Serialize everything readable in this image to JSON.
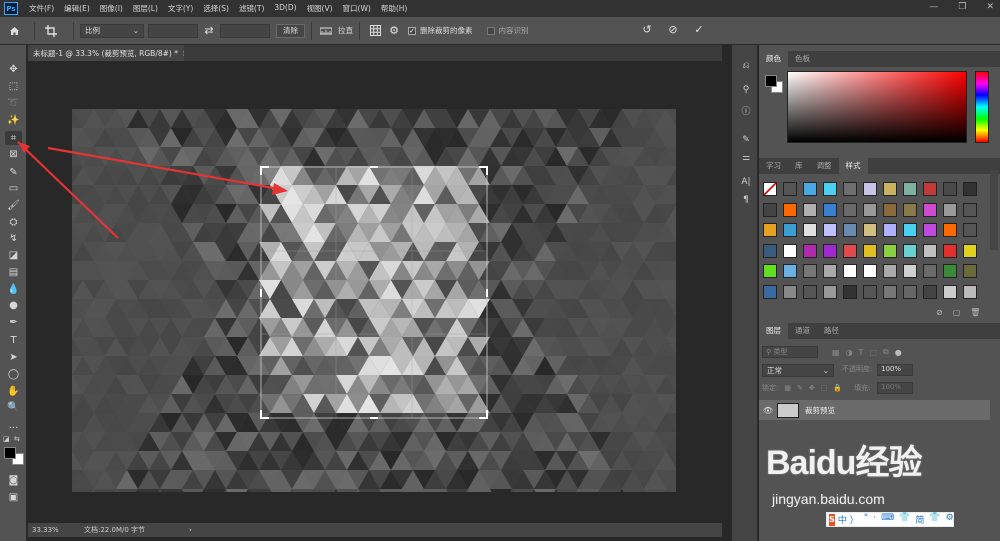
{
  "app": {
    "logo": "Ps"
  },
  "menu": [
    "文件(F)",
    "编辑(E)",
    "图像(I)",
    "图层(L)",
    "文字(Y)",
    "选择(S)",
    "滤镜(T)",
    "3D(D)",
    "视图(V)",
    "窗口(W)",
    "帮助(H)"
  ],
  "window_controls": {
    "minimize": "—",
    "restore": "❐",
    "close": "✕"
  },
  "options": {
    "ratio_select": "比例",
    "clear_button": "清除",
    "straighten_label": "拉直",
    "delete_cropped_label": "删除裁剪的像素",
    "delete_cropped_checked": true,
    "content_aware_label": "内容识别",
    "content_aware_checked": false,
    "swap_icon": "⇄",
    "reset_icon": "↺",
    "cancel_icon": "⊘",
    "commit_icon": "✓"
  },
  "document": {
    "tab_title": "未标题-1 @ 33.3% (裁剪预览, RGB/8#) *",
    "close": "×"
  },
  "status": {
    "zoom": "33.33%",
    "doc_info": "文档:22.0M/0 字节",
    "arrow": "›"
  },
  "tools": [
    {
      "name": "move-tool-icon",
      "glyph": "✥"
    },
    {
      "name": "marquee-tool-icon",
      "glyph": "⬚"
    },
    {
      "name": "lasso-tool-icon",
      "glyph": "➰"
    },
    {
      "name": "magic-wand-tool-icon",
      "glyph": "✨"
    },
    {
      "name": "crop-tool-icon",
      "glyph": "⌗"
    },
    {
      "name": "frame-tool-icon",
      "glyph": "⊠"
    },
    {
      "name": "eyedropper-tool-icon",
      "glyph": "✎"
    },
    {
      "name": "healing-brush-tool-icon",
      "glyph": "▭"
    },
    {
      "name": "brush-tool-icon",
      "glyph": "🖌"
    },
    {
      "name": "clone-stamp-tool-icon",
      "glyph": "⛭"
    },
    {
      "name": "history-brush-tool-icon",
      "glyph": "↯"
    },
    {
      "name": "eraser-tool-icon",
      "glyph": "◪"
    },
    {
      "name": "gradient-tool-icon",
      "glyph": "▤"
    },
    {
      "name": "blur-tool-icon",
      "glyph": "💧"
    },
    {
      "name": "dodge-tool-icon",
      "glyph": "●"
    },
    {
      "name": "pen-tool-icon",
      "glyph": "✒"
    },
    {
      "name": "type-tool-icon",
      "glyph": "T"
    },
    {
      "name": "path-selection-tool-icon",
      "glyph": "➤"
    },
    {
      "name": "shape-tool-icon",
      "glyph": "◯"
    },
    {
      "name": "hand-tool-icon",
      "glyph": "✋"
    },
    {
      "name": "zoom-tool-icon",
      "glyph": "🔍"
    },
    {
      "name": "more-tools-icon",
      "glyph": "···"
    }
  ],
  "panels": {
    "color_tabs": [
      "颜色",
      "色板"
    ],
    "style_tabs": [
      "字习",
      "库",
      "调整",
      "样式"
    ],
    "layer_tabs": [
      "图层",
      "通道",
      "路径"
    ],
    "layer_filter": "类型",
    "blend_mode": "正常",
    "opacity_label": "不透明度:",
    "opacity_value": "100%",
    "lock_label": "锁定:",
    "fill_label": "填充:",
    "fill_value": "100%",
    "layer_name": "裁剪预览",
    "eye_icon": "👁"
  },
  "watermark": {
    "brand": "Baidu经验",
    "url": "jingyan.baidu.com"
  },
  "ime": {
    "lang": "中",
    "glyphs": [
      "）",
      "°",
      "·",
      "⌨",
      "👕",
      "简",
      "👕",
      "⚙"
    ]
  },
  "colors": {
    "accent_blue": "#31a8ff",
    "arrow_red": "#e43434",
    "crop_handle": "#ffffff"
  },
  "style_swatches": [
    "#ffffff",
    "#555555",
    "#4aa8e6",
    "#4ad0f0",
    "#6f6f6f",
    "#c7c5e5",
    "#c9b35f",
    "#7fb1a3",
    "#c23a3a",
    "#4a4a4a",
    "#333333",
    "#444444",
    "#ff6a00",
    "#b0b0b0",
    "#3a7fd0",
    "#6a6a6a",
    "#999999",
    "#8a6a3a",
    "#8a7a4a",
    "#d04ad0",
    "#9a9a9a",
    "#555555",
    "#e8a020",
    "#3a9ed0",
    "#e0e0e0",
    "#c0c0ff",
    "#6a8ab0",
    "#d0c080",
    "#b0b0ff",
    "#4ad0f0",
    "#c04ae0",
    "#ff6a00",
    "#555555",
    "#3a5a80",
    "#ffffff",
    "#b02ab0",
    "#a02ad0",
    "#e04a4a",
    "#e0c020",
    "#8ad040",
    "#6ad0d0",
    "#c0c0c0",
    "#e03030",
    "#e0d020",
    "#60e020",
    "#6ab0e0",
    "#777777",
    "#aaaaaa",
    "#ffffff",
    "#ffffff",
    "#aaaaaa",
    "#d0d0d0",
    "#6a6a6a",
    "#3a8a3a",
    "#6a6a3a",
    "#3a6aa0",
    "#888888",
    "#555555",
    "#999999",
    "#333333",
    "#555555",
    "#777777",
    "#666666",
    "#444444",
    "#cccccc",
    "#bbbbbb"
  ]
}
